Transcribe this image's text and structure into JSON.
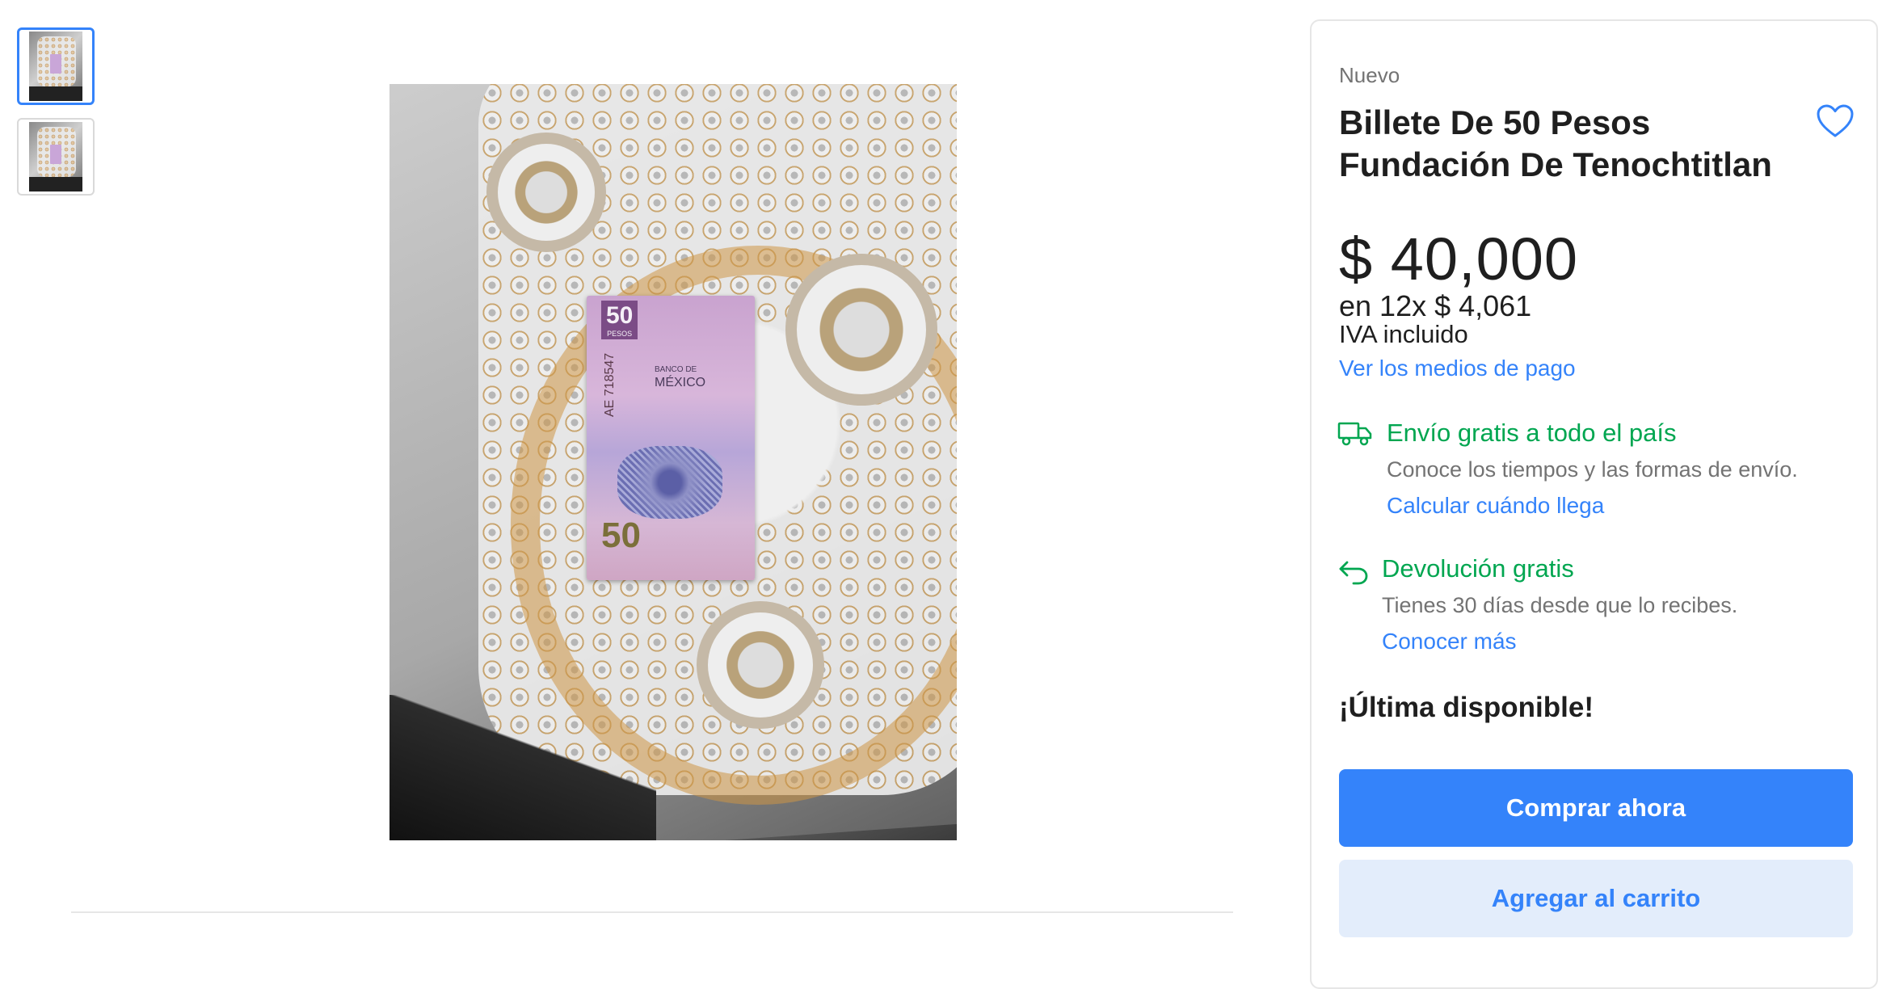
{
  "product": {
    "condition": "Nuevo",
    "title": "Billete De 50 Pesos Fundación De Tenochtitlan",
    "price": "$ 40,000",
    "installments": "en 12x $ 4,061",
    "tax_note": "IVA incluido",
    "payment_link": "Ver los medios de pago",
    "stock_note": "¡Última disponible!"
  },
  "shipping": {
    "title": "Envío gratis a todo el país",
    "subtitle": "Conoce los tiempos y las formas de envío.",
    "link": "Calcular cuándo llega",
    "icon": "truck-icon"
  },
  "returns": {
    "title": "Devolución gratis",
    "subtitle": "Tienes 30 días desde que lo recibes.",
    "link": "Conocer más",
    "icon": "return-arrow-icon"
  },
  "actions": {
    "buy_now": "Comprar ahora",
    "add_to_cart": "Agregar al carrito",
    "favorite_icon": "heart-icon"
  },
  "gallery": {
    "thumbnails": [
      "banknote-photo-1",
      "banknote-photo-2"
    ],
    "selected_index": 0,
    "note_text": {
      "denomination": "50",
      "denomination_label": "PESOS",
      "bank_line1": "BANCO DE",
      "bank_line2": "MÉXICO",
      "serial": "AE 718547"
    }
  },
  "colors": {
    "accent": "#3483fa",
    "success": "#00a650",
    "secondary_button_bg": "#e3edfb"
  }
}
